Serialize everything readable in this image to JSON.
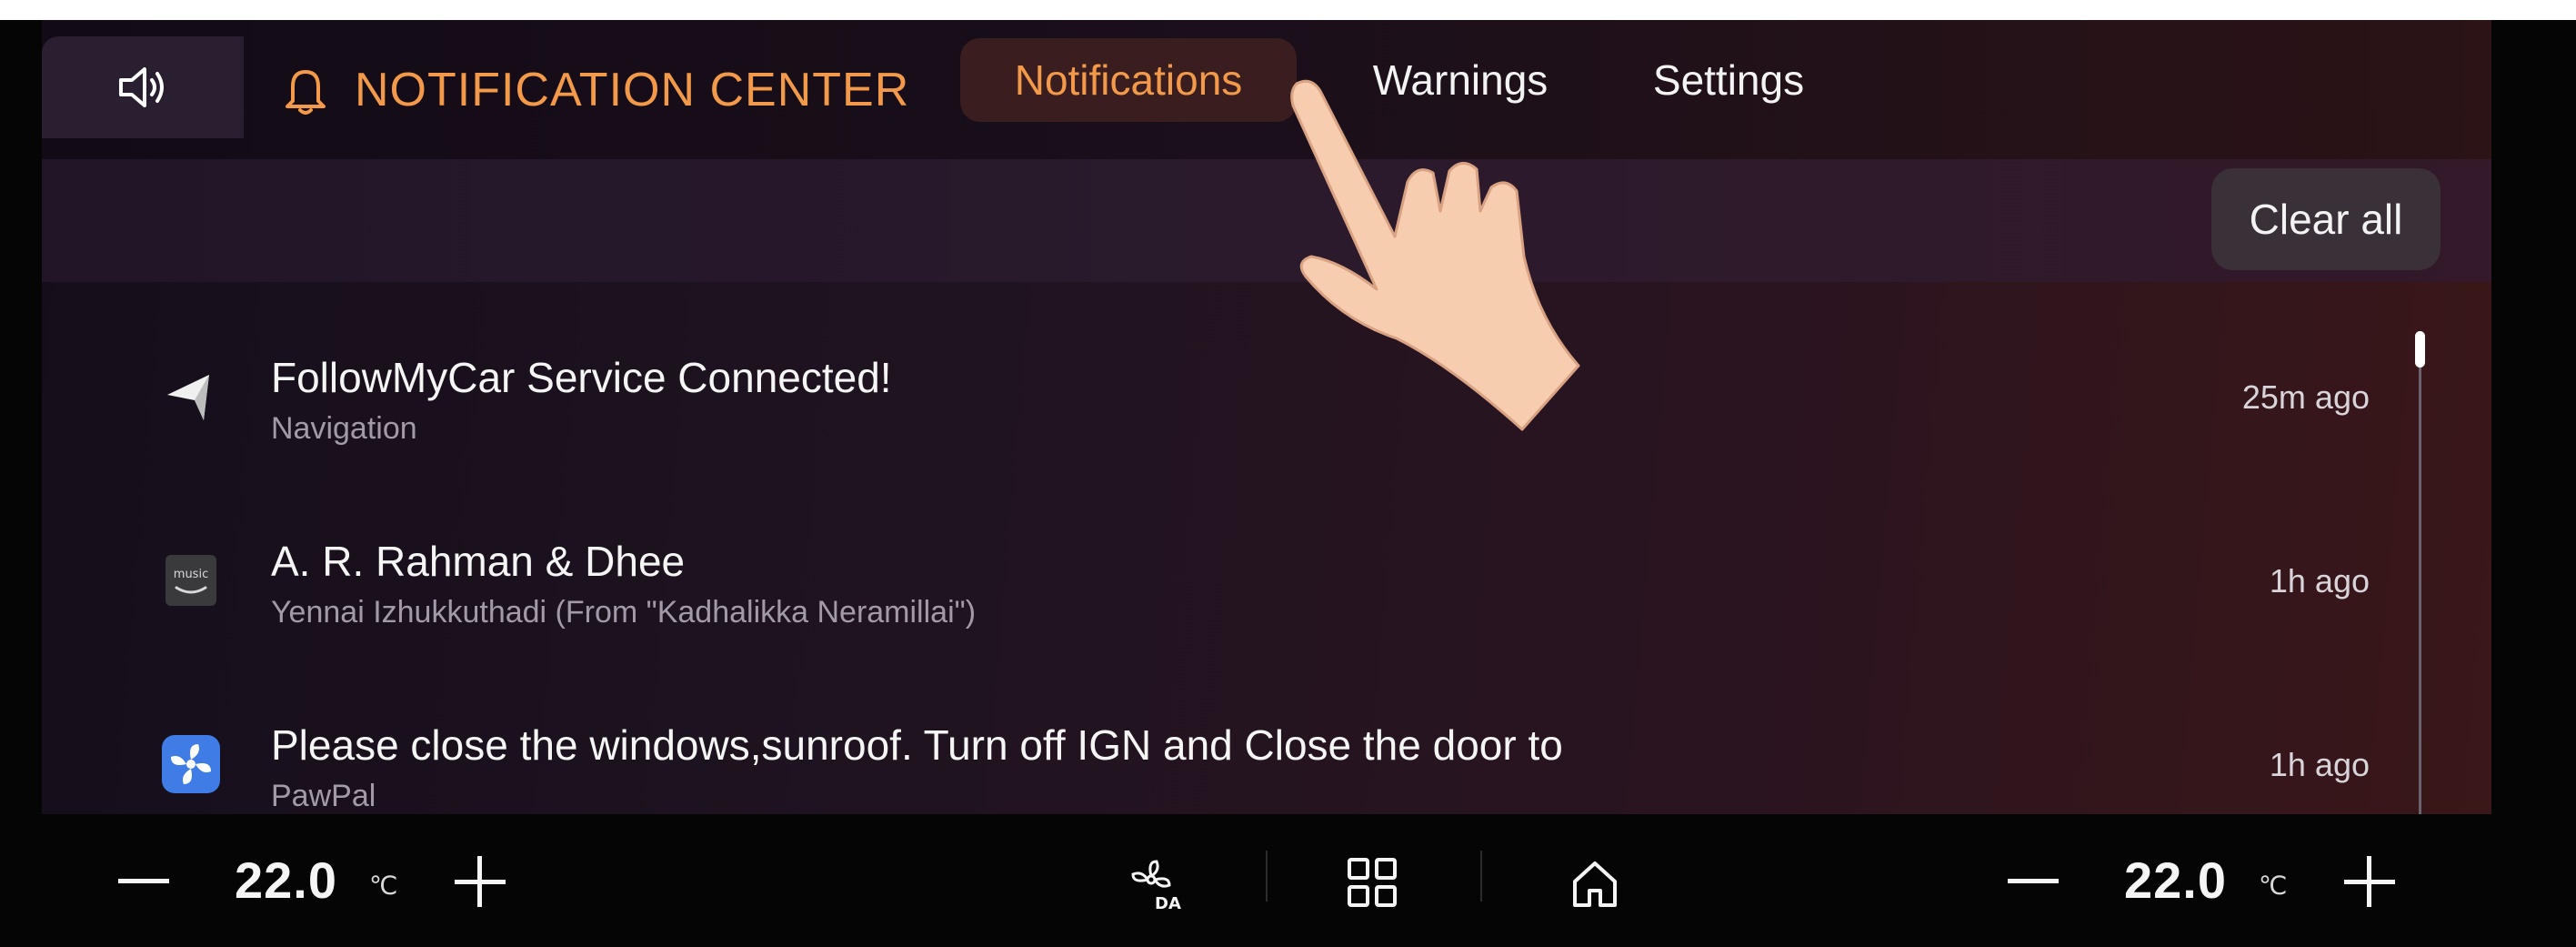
{
  "header": {
    "title": "NOTIFICATION CENTER",
    "sound_icon": "speaker-icon",
    "bell_icon": "bell-icon",
    "tabs": [
      {
        "label": "Notifications",
        "active": true
      },
      {
        "label": "Warnings",
        "active": false
      },
      {
        "label": "Settings",
        "active": false
      }
    ],
    "accent_color": "#f2994a"
  },
  "actions": {
    "clear_all": "Clear all"
  },
  "notifications": [
    {
      "title": "FollowMyCar Service Connected!",
      "source": "Navigation",
      "time": "25m ago",
      "icon": "navigation-arrow-icon"
    },
    {
      "title": "A. R. Rahman & Dhee",
      "source": "Yennai Izhukkuthadi (From \"Kadhalikka Neramillai\")",
      "time": "1h ago",
      "icon": "amazon-music-icon"
    },
    {
      "title": "Please close the windows,sunroof. Turn off IGN and Close the door to",
      "source": "PawPal",
      "time": "1h ago",
      "icon": "pawpal-fan-icon"
    }
  ],
  "climate": {
    "left": {
      "temp": "22.0",
      "unit": "℃"
    },
    "right": {
      "temp": "22.0",
      "unit": "℃"
    }
  },
  "dock_icons": [
    "fan-auto-icon",
    "apps-grid-icon",
    "home-icon"
  ]
}
